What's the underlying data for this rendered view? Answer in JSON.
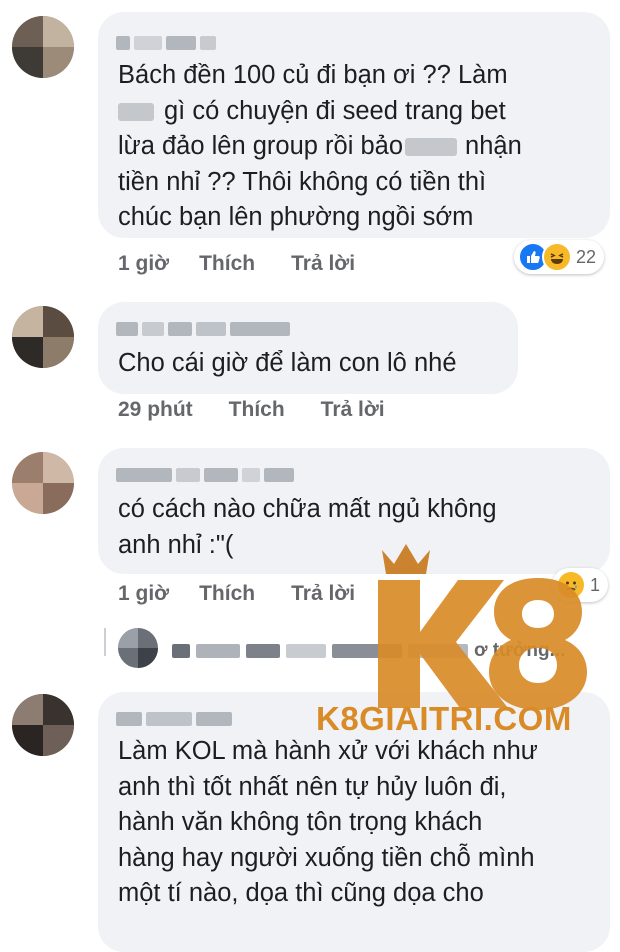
{
  "comments": [
    {
      "lines": [
        "Bách đền 100 củ đi bạn ơi ?? Làm",
        "gì có chuyện đi seed trang bet",
        "lừa đảo lên group rồi bảo",
        "nhận",
        "tiền nhỉ ?? Thôi không có tiền thì",
        "chúc bạn lên phường ngồi sớm"
      ],
      "time": "1 giờ",
      "like": "Thích",
      "reply": "Trả lời",
      "reaction_count": "22",
      "reaction_icons": [
        "like-icon",
        "haha-icon"
      ]
    },
    {
      "lines": [
        "Cho cái giờ để làm con lô nhé"
      ],
      "time": "29 phút",
      "like": "Thích",
      "reply": "Trả lời"
    },
    {
      "lines": [
        "có cách nào chữa mất ngủ không",
        "anh nhỉ :\"("
      ],
      "time": "1 giờ",
      "like": "Thích",
      "reply": "Trả lời",
      "reaction_count": "1",
      "reaction_icons": [
        "sad-icon"
      ]
    },
    {
      "lines": [
        "Làm KOL mà hành xử với khách như",
        "anh thì tốt nhất nên tự hủy luôn đi,",
        "hành văn không tôn trọng khách",
        "hàng hay người xuống tiền chỗ mình",
        "một tí nào, dọa thì cũng dọa cho"
      ]
    }
  ],
  "reply_preview": {
    "text": "ơ tưởng..."
  },
  "watermark": {
    "logo": "K8",
    "site": "K8GIAITRI.COM",
    "color": "#d98b28"
  }
}
